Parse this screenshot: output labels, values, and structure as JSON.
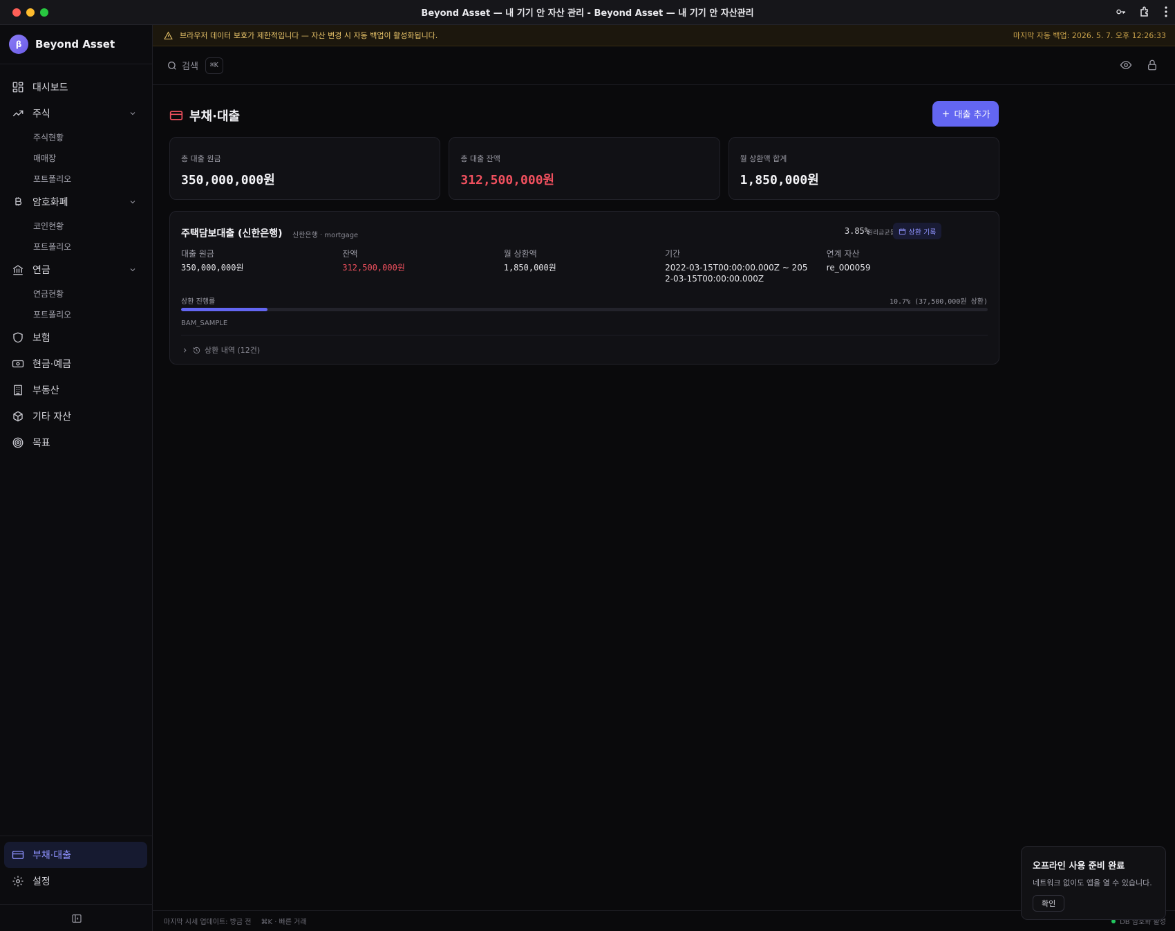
{
  "window": {
    "title": "Beyond Asset — 내 기기 안 자산 관리 - Beyond Asset — 내 기기 안 자산관리"
  },
  "brand": {
    "logo_letter": "β",
    "name": "Beyond Asset"
  },
  "sidebar": {
    "items": [
      {
        "label": "대시보드",
        "icon": "dashboard-icon"
      },
      {
        "label": "주식",
        "icon": "trending-up-icon",
        "subs": [
          "주식현황",
          "매매장",
          "포트폴리오"
        ]
      },
      {
        "label": "암호화폐",
        "icon": "bitcoin-icon",
        "subs": [
          "코인현황",
          "포트폴리오"
        ]
      },
      {
        "label": "연금",
        "icon": "bank-icon",
        "subs": [
          "연금현황",
          "포트폴리오"
        ]
      },
      {
        "label": "보험",
        "icon": "shield-icon"
      },
      {
        "label": "현금·예금",
        "icon": "banknote-icon"
      },
      {
        "label": "부동산",
        "icon": "building-icon"
      },
      {
        "label": "기타 자산",
        "icon": "package-icon"
      },
      {
        "label": "목표",
        "icon": "target-icon"
      }
    ],
    "bottom": [
      {
        "label": "부채·대출",
        "icon": "credit-card-icon",
        "active": true
      },
      {
        "label": "설정",
        "icon": "gear-icon"
      }
    ]
  },
  "banner": {
    "message": "브라우저 데이터 보호가 제한적입니다 — 자산 변경 시 자동 백업이 활성화됩니다.",
    "last_backup": "마지막 자동 백업: 2026. 5. 7. 오후 12:26:33"
  },
  "topbar": {
    "search_label": "검색",
    "shortcut": "⌘K"
  },
  "page": {
    "title": "부채·대출",
    "add_button": "대출 추가"
  },
  "stats": [
    {
      "label": "총 대출 원금",
      "value": "350,000,000원",
      "color": "#f4f4f7"
    },
    {
      "label": "총 대출 잔액",
      "value": "312,500,000원",
      "color": "#f0505e"
    },
    {
      "label": "월 상환액 합계",
      "value": "1,850,000원",
      "color": "#f4f4f7"
    }
  ],
  "loan": {
    "name": "주택담보대출 (신한은행)",
    "meta": "신한은행 · mortgage",
    "rate": "3.85%",
    "repayment_type": "원리금균등",
    "repay_button": "상환 기록",
    "fields": [
      {
        "label": "대출 원금",
        "value": "350,000,000원"
      },
      {
        "label": "잔액",
        "value": "312,500,000원"
      },
      {
        "label": "월 상환액",
        "value": "1,850,000원"
      },
      {
        "label": "기간",
        "value": "2022-03-15T00:00:00.000Z ~ 2052-03-15T00:00:00.000Z"
      },
      {
        "label": "연계 자산",
        "value": "re_000059"
      }
    ],
    "progress_label": "상환 진행률",
    "progress_text": "10.7% (37,500,000원 상환)",
    "progress_fraction": 0.107,
    "tag": "BAM_SAMPLE",
    "history_label": "상환 내역 (12건)"
  },
  "statusbar": {
    "last_update": "마지막 시세 업데이트: 방금 전",
    "shortcut_hint": "⌘K · 빠른 거래",
    "db_status": "DB 암호화 활성"
  },
  "toast": {
    "title": "오프라인 사용 준비 완료",
    "body": "네트워크 없이도 앱을 열 수 있습니다.",
    "confirm": "확인"
  },
  "colors": {
    "accent": "#6366f1",
    "danger": "#f0505e",
    "warning": "#e9c46a"
  }
}
